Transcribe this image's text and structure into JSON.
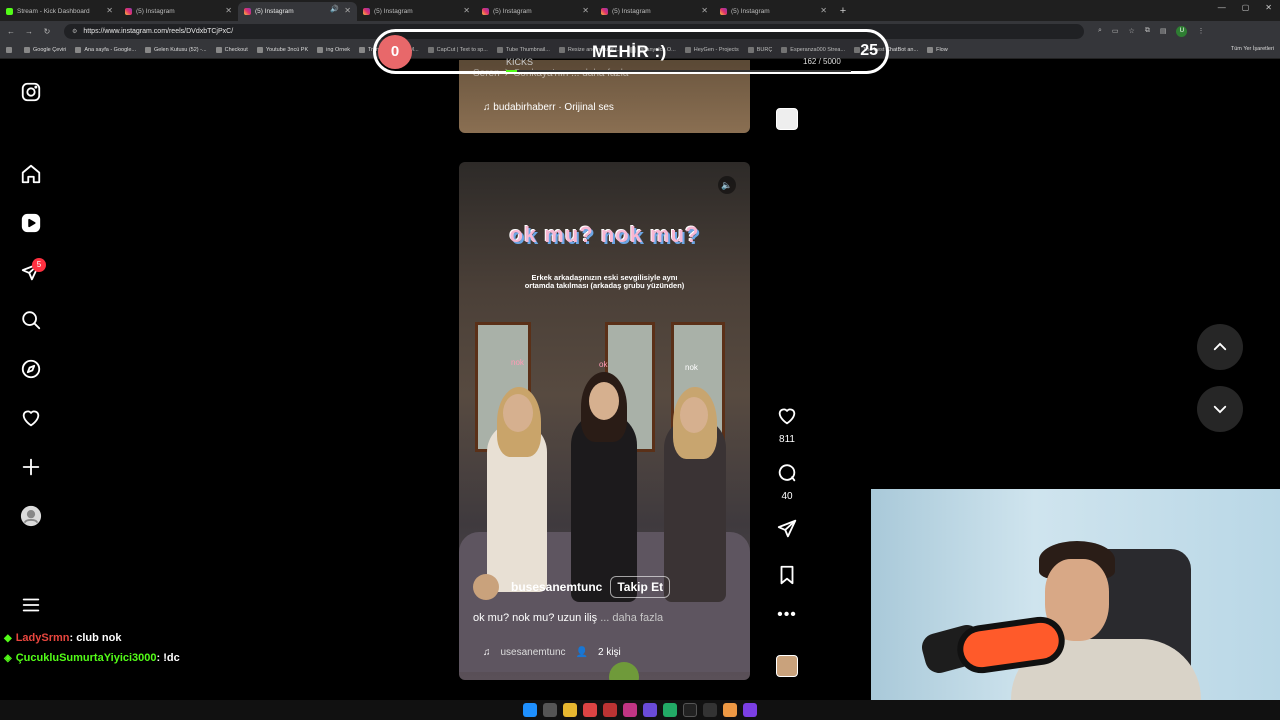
{
  "browser": {
    "tabs": [
      {
        "title": "Stream - Kick Dashboard",
        "icon": "kick-icon"
      },
      {
        "title": "(5) Instagram",
        "icon": "instagram-icon"
      },
      {
        "title": "(5) Instagram",
        "icon": "instagram-icon",
        "active": true
      },
      {
        "title": "(5) Instagram",
        "icon": "instagram-icon"
      },
      {
        "title": "(5) Instagram",
        "icon": "instagram-icon"
      },
      {
        "title": "(5) Instagram",
        "icon": "instagram-icon"
      },
      {
        "title": "(5) Instagram",
        "icon": "instagram-icon"
      }
    ],
    "url": "https://www.instagram.com/reels/DVdxbTCjPxC/",
    "bookmarks": [
      "Google Çeviri",
      "Ana sayfa - Google...",
      "Gelen Kutusu (52) -...",
      "Checkout",
      "Youtube 3ncü PK",
      "ing Örnek",
      "Transcript of \"Mİ M...",
      "CapCut | Text to sp...",
      "Tube Thumbnail...",
      "Resize and reduce i...",
      "İspanyolca Ö...",
      "HeyGen - Projects",
      "BURÇ",
      "Esperanza000 Strea...",
      "The best ChatBot an...",
      "Flow"
    ],
    "bookmarks_right": "Tüm Yer İşaretleri"
  },
  "sidebar": {
    "icons": [
      "instagram-logo-icon",
      "home-icon",
      "reels-icon",
      "direct-messages-icon",
      "search-icon",
      "explore-icon",
      "notifications-heart-icon",
      "create-icon",
      "profile-icon",
      "more-menu-icon"
    ],
    "notification_badge": "5"
  },
  "previous_reel": {
    "caption_blur": "Seren ✈ Sonkaya'nın ... daha fazla",
    "audio": "budabirhaberr · Orijinal ses"
  },
  "reel": {
    "title": "ok mu? nok mu?",
    "subtitle": "Erkek arkadaşınızın eski sevgilisiyle aynı ortamda takılması (arkadaş grubu yüzünden)",
    "tag_left": "nok",
    "tag_mid": "ok",
    "tag_right": "nok",
    "author": "busesanemtunc",
    "follow_label": "Takip Et",
    "caption": "ok mu? nok mu? uzun iliş",
    "caption_more": "... daha fazla",
    "audio_name": "usesanemtunc",
    "tagged_people": "2 kişi",
    "likes": "811",
    "comments": "40"
  },
  "kicks_overlay": {
    "count": "0",
    "label": "KICKS",
    "title": "MEHİR :)",
    "goal": "25",
    "progress": "162 / 5000",
    "progress_fraction": 0.032,
    "accent": "#53fc18"
  },
  "chat": [
    {
      "user": "LadySrmn",
      "message": ": club nok"
    },
    {
      "user": "ÇucukluSumurtaYiyici3000",
      "message": ": !dc"
    }
  ],
  "colors": {
    "badge": "#ff3040",
    "kick_green": "#53fc18",
    "kicks_count_bg": "#e8686a"
  }
}
